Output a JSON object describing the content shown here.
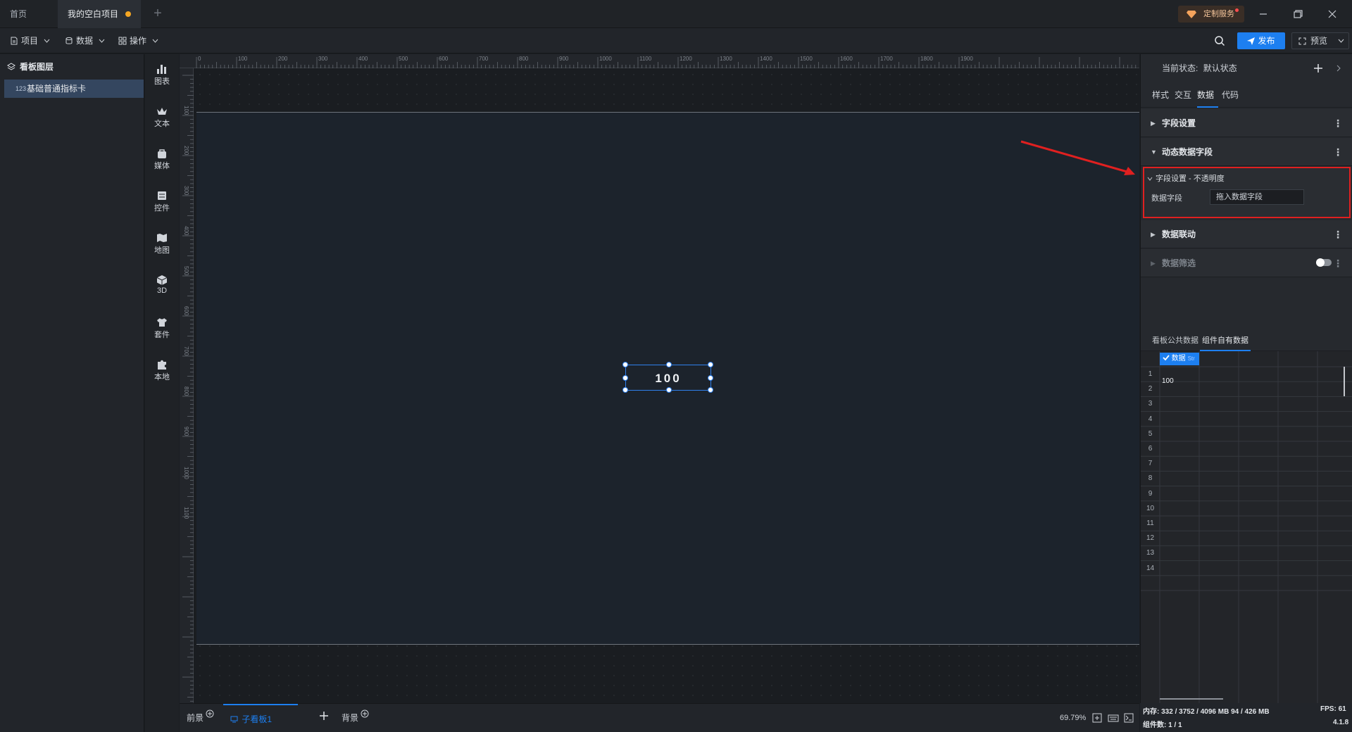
{
  "titlebar": {
    "tabs": [
      {
        "label": "首页"
      },
      {
        "label": "我的空白项目"
      }
    ],
    "custom_service": "定制服务"
  },
  "toolbar": {
    "menus": [
      "项目",
      "数据",
      "操作"
    ],
    "publish": "发布",
    "preview": "预览"
  },
  "layers": {
    "title": "看板图层",
    "items": [
      {
        "label": "基础普通指标卡"
      }
    ]
  },
  "iconbar": {
    "items": [
      "图表",
      "文本",
      "媒体",
      "控件",
      "地图",
      "3D",
      "套件",
      "本地"
    ]
  },
  "ruler": {
    "h_labels": [
      "0",
      "100",
      "200",
      "300",
      "400",
      "500",
      "600",
      "700",
      "800",
      "900",
      "1000",
      "1100",
      "1200",
      "1300",
      "1400",
      "1500",
      "1600",
      "1700",
      "1800",
      "1900"
    ],
    "v_labels": [
      "100",
      "200",
      "300",
      "400",
      "500",
      "600",
      "700",
      "800",
      "900",
      "1000",
      "1100"
    ]
  },
  "canvas": {
    "widget_value": "100"
  },
  "bottombar": {
    "foreground": "前景",
    "subboard": "子看板1",
    "background": "背景",
    "zoom": "69.79%"
  },
  "rightpanel": {
    "state_label": "当前状态:",
    "state_value": "默认状态",
    "tabs": [
      "样式",
      "交互",
      "数据",
      "代码"
    ],
    "active_tab": "数据",
    "sections": {
      "field_settings": "字段设置",
      "dynamic_fields": "动态数据字段",
      "data_linkage": "数据联动",
      "data_filter": "数据筛选"
    },
    "highlight_box": {
      "title": "字段设置 - 不透明度",
      "field_label": "数据字段",
      "field_placeholder": "拖入数据字段"
    },
    "data_tabs": [
      "看板公共数据",
      "组件自有数据"
    ],
    "grid": {
      "column_header": "数据",
      "column_type": "Str",
      "row_numbers": [
        "1",
        "2",
        "3",
        "4",
        "5",
        "6",
        "7",
        "8",
        "9",
        "10",
        "11",
        "12",
        "13",
        "14"
      ],
      "cells": [
        "100"
      ]
    }
  },
  "statusbar": {
    "memory_label": "内存:",
    "memory_value": "332 / 3752 / 4096 MB",
    "memory_value2": "94 / 426 MB",
    "fps_label": "FPS:",
    "fps_value": "61",
    "count_label": "组件数:",
    "count_value": "1 / 1",
    "version": "4.1.8"
  },
  "colors": {
    "accent": "#1d7ff0",
    "highlight_box": "#e02020",
    "arrow": "#e02020"
  }
}
